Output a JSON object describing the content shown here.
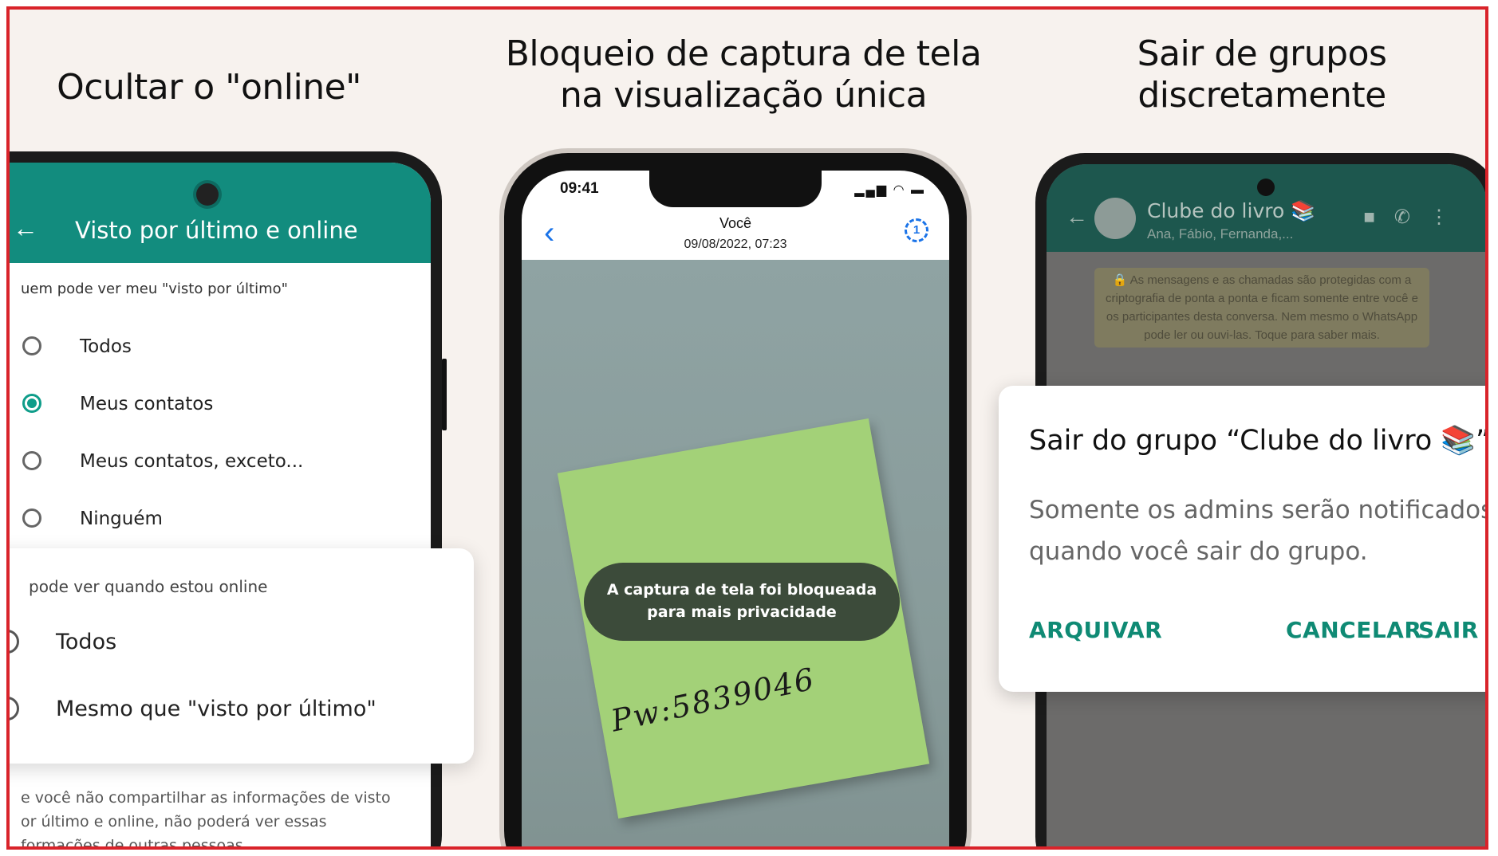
{
  "headings": {
    "left": "Ocultar o \"online\"",
    "center_line1": "Bloqueio de captura de tela",
    "center_line2": "na visualização única",
    "right_line1": "Sair de grupos",
    "right_line2": "discretamente"
  },
  "phone_privacy": {
    "title": "Visto por último e online",
    "section_last_seen": "uem pode ver meu \"visto por último\"",
    "options": [
      {
        "label": "Todos",
        "selected": false
      },
      {
        "label": "Meus contatos",
        "selected": true
      },
      {
        "label": "Meus contatos, exceto...",
        "selected": false
      },
      {
        "label": "Ninguém",
        "selected": false
      }
    ],
    "online_card": {
      "section": "pode ver quando estou online",
      "options": [
        "Todos",
        "Mesmo que \"visto por último\""
      ]
    },
    "footer_line1": "e você não compartilhar as informações de visto",
    "footer_line2": "or último e online, não poderá ver essas",
    "footer_line3": "formações de outras pessoas."
  },
  "phone_viewonce": {
    "time": "09:41",
    "contact": "Você",
    "datetime": "09/08/2022, 07:23",
    "once_badge": "1",
    "toast_line1": "A captura de tela foi bloqueada",
    "toast_line2": "para mais privacidade",
    "note_text": "Pw:5839046"
  },
  "phone_group": {
    "group_name": "Clube do livro 📚",
    "members": "Ana, Fábio, Fernanda,...",
    "encryption_line1": "🔒 As mensagens e as chamadas são protegidas com a",
    "encryption_line2": "criptografia de ponta a ponta e ficam somente entre você e",
    "encryption_line3": "os participantes desta conversa. Nem mesmo o WhatsApp",
    "encryption_line4": "pode ler ou ouvi-las. Toque para saber mais.",
    "dialog": {
      "title": "Sair do grupo “Clube do livro 📚”?",
      "body": "Somente os admins serão notificados quando você sair do grupo.",
      "archive": "ARQUIVAR",
      "cancel": "CANCELAR",
      "leave": "SAIR"
    }
  },
  "colors": {
    "whatsapp_green": "#128c7e",
    "radio_green": "#0f9d8a",
    "action_green": "#0f8a74",
    "frame_red": "#d9232a"
  }
}
